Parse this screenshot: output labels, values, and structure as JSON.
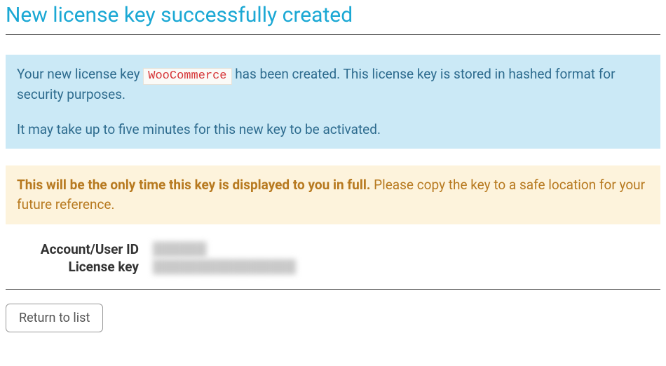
{
  "title": "New license key successfully created",
  "info": {
    "part1": "Your new license key ",
    "tag": "WooCommerce",
    "part2": " has been created. This license key is stored in hashed format for security purposes.",
    "line2": "It may take up to five minutes for this new key to be activated."
  },
  "warning": {
    "bold": "This will be the only time this key is displayed to you in full.",
    "rest": " Please copy the key to a safe location for your future reference."
  },
  "details": {
    "account_label": "Account/User ID",
    "account_value": "██████",
    "license_label": "License key",
    "license_value": "████████████████"
  },
  "actions": {
    "return_label": "Return to list"
  }
}
